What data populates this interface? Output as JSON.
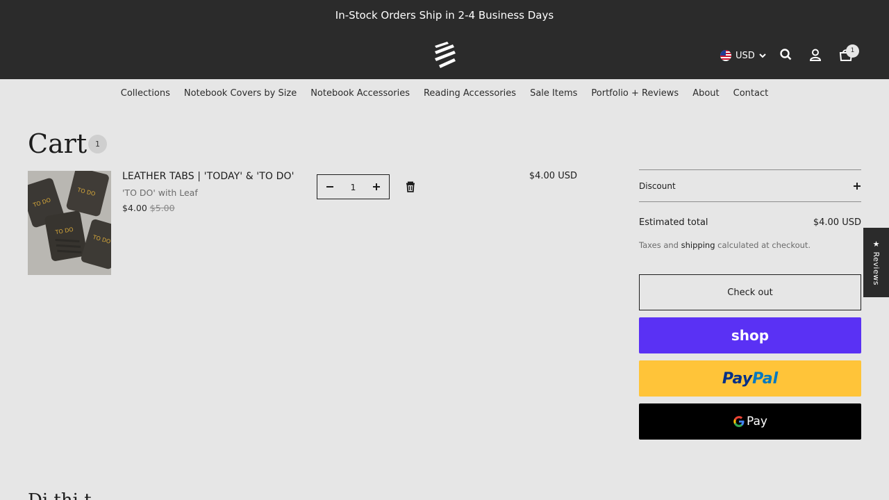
{
  "announcement": "In-Stock Orders Ship in 2-4 Business Days",
  "header": {
    "currency": "USD",
    "cart_count": "1"
  },
  "nav": [
    {
      "label": "Collections"
    },
    {
      "label": "Notebook Covers by Size"
    },
    {
      "label": "Notebook Accessories"
    },
    {
      "label": "Reading Accessories"
    },
    {
      "label": "Sale Items"
    },
    {
      "label": "Portfolio + Reviews"
    },
    {
      "label": "About"
    },
    {
      "label": "Contact"
    }
  ],
  "cart": {
    "title": "Cart",
    "count": "1",
    "items": [
      {
        "title": "LEATHER TABS | 'TODAY' & 'TO DO'",
        "variant": "'TO DO' with Leaf",
        "price": "$4.00",
        "compare_price": "$5.00",
        "quantity": "1",
        "line_total": "$4.00 USD",
        "image_text": "TO DO"
      }
    ]
  },
  "summary": {
    "discount_label": "Discount",
    "estimated_total_label": "Estimated total",
    "estimated_total_value": "$4.00 USD",
    "tax_prefix": "Taxes and",
    "tax_link": "shipping",
    "tax_suffix": "calculated at checkout.",
    "checkout_label": "Check out",
    "shop_pay_label": "shop",
    "paypal_label_1": "Pay",
    "paypal_label_2": "Pal",
    "gpay_label": "Pay"
  },
  "reviews_tab": "★ Reviews",
  "bottom_heading": "Di                    thi   t",
  "colors": {
    "announcement_bg": "#2b2b2b",
    "page_bg": "#e6e6e6",
    "shop_pay": "#5a31f4",
    "paypal": "#ffc439",
    "gpay": "#000000"
  }
}
